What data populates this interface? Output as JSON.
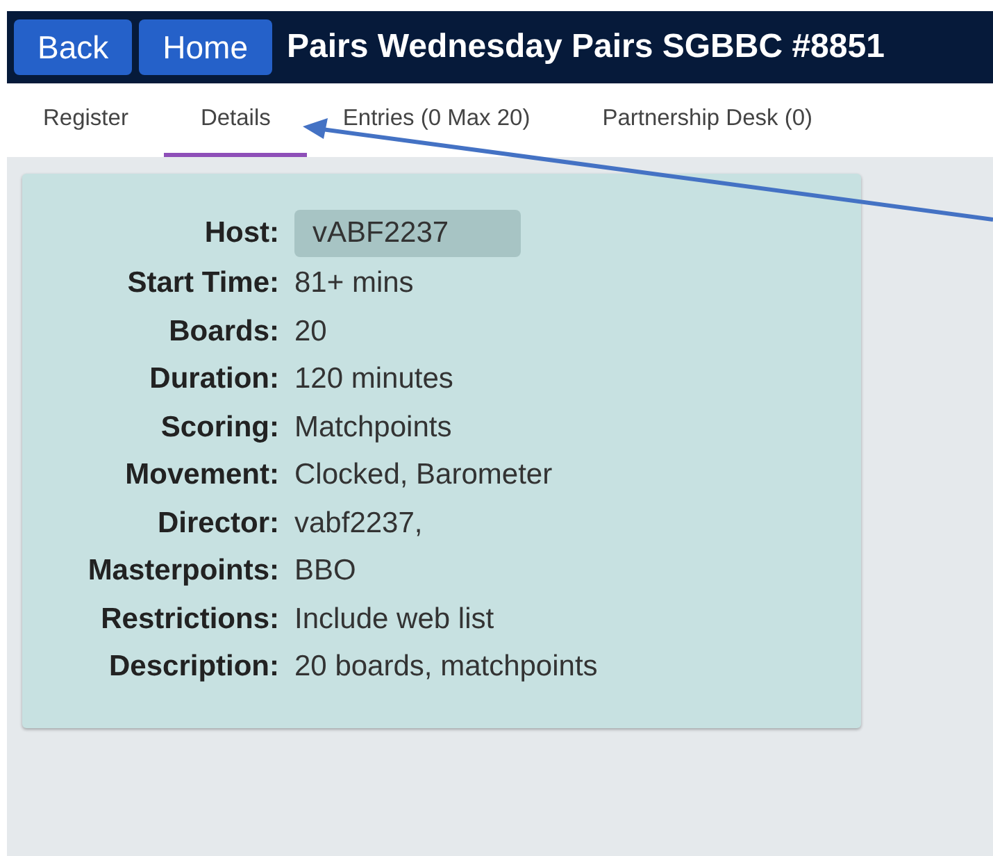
{
  "header": {
    "buttons": [
      "Back",
      "Home"
    ],
    "title": "Pairs Wednesday Pairs SGBBC #8851"
  },
  "tabs": [
    {
      "label": "Register",
      "selected": false
    },
    {
      "label": "Details",
      "selected": true
    },
    {
      "label": "Entries (0 Max 20)",
      "selected": false
    },
    {
      "label": "Partnership Desk (0)",
      "selected": false
    }
  ],
  "details": [
    {
      "label": "Host:",
      "value": "vABF2237",
      "kind": "field"
    },
    {
      "label": "Start Time:",
      "value": "81+ mins",
      "kind": "text"
    },
    {
      "label": "Boards:",
      "value": "20",
      "kind": "text"
    },
    {
      "label": "Duration:",
      "value": "120 minutes",
      "kind": "text"
    },
    {
      "label": "Scoring:",
      "value": "Matchpoints",
      "kind": "text"
    },
    {
      "label": "Movement:",
      "value": "Clocked, Barometer",
      "kind": "text"
    },
    {
      "label": "Director:",
      "value": "vabf2237,",
      "kind": "text"
    },
    {
      "label": "Masterpoints:",
      "value": "BBO",
      "kind": "text"
    },
    {
      "label": "Restrictions:",
      "value": "Include web list",
      "kind": "text"
    },
    {
      "label": "Description:",
      "value": "20 boards, matchpoints",
      "kind": "text"
    }
  ]
}
